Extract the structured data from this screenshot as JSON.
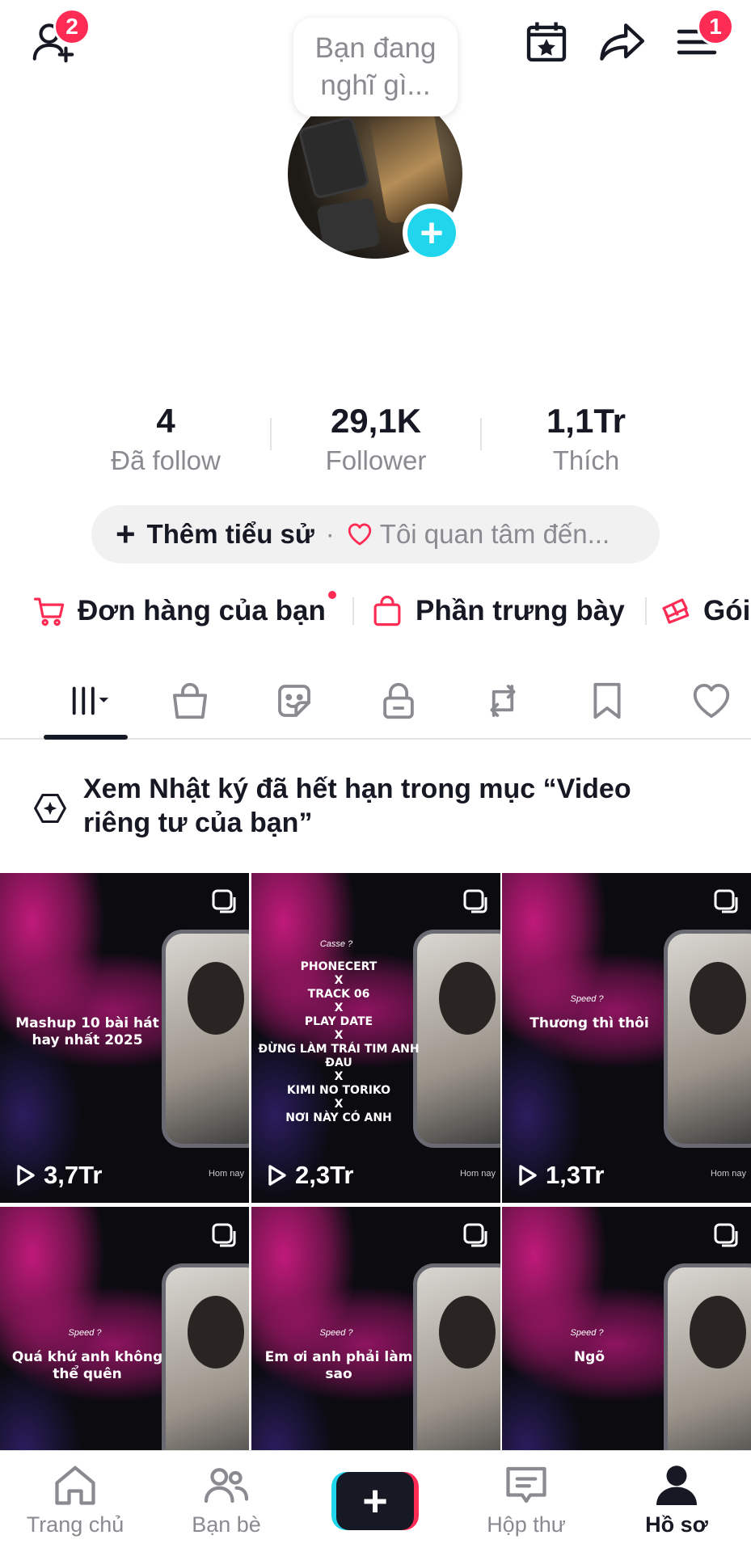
{
  "top_bar": {
    "add_friends_badge": "2",
    "menu_badge": "1"
  },
  "profile": {
    "thought_bubble": "Bạn đang nghĩ gì..."
  },
  "stats": [
    {
      "value": "4",
      "label": "Đã follow"
    },
    {
      "value": "29,1K",
      "label": "Follower"
    },
    {
      "value": "1,1Tr",
      "label": "Thích"
    }
  ],
  "bio": {
    "add_bio": "Thêm tiểu sử",
    "separator": "·",
    "interest": "Tôi quan tâm đến..."
  },
  "shortcuts": [
    {
      "label": "Đơn hàng của bạn",
      "icon": "cart-icon"
    },
    {
      "label": "Phần trưng bày",
      "icon": "shopping-bag-icon"
    },
    {
      "label": "Gói",
      "icon": "gift-icon"
    }
  ],
  "tabs": [
    {
      "icon": "videos-grid-icon",
      "active": true
    },
    {
      "icon": "shop-bag-icon"
    },
    {
      "icon": "sticker-icon"
    },
    {
      "icon": "lock-icon"
    },
    {
      "icon": "repost-icon"
    },
    {
      "icon": "bookmark-icon"
    },
    {
      "icon": "heart-icon"
    }
  ],
  "notice": {
    "text": "Xem Nhật ký đã hết hạn trong mục “Video riêng tư của bạn”"
  },
  "videos": [
    {
      "title": "Mashup 10 bài hát hay nhất 2025",
      "speed": "",
      "views": "3,7Tr",
      "corner": "Hom nay"
    },
    {
      "title": "PHONECERT\nX\nTRACK 06\nX\nPLAY DATE\nX\nĐỪNG LÀM TRÁI TIM ANH ĐAU\nX\nKIMI NO TORIKO\nX\nNƠI NÀY CÓ ANH",
      "speed": "Casse ?",
      "views": "2,3Tr",
      "corner": "Hom nay"
    },
    {
      "title": "Thương thì thôi",
      "speed": "Speed ?",
      "views": "1,3Tr",
      "corner": "Hom nay"
    },
    {
      "title": "Quá khứ anh không thể quên",
      "speed": "Speed ?",
      "views": "",
      "corner": ""
    },
    {
      "title": "Em ơi anh phải làm sao",
      "speed": "Speed ?",
      "views": "",
      "corner": ""
    },
    {
      "title": "Ngõ",
      "speed": "Speed ?",
      "views": "",
      "corner": ""
    }
  ],
  "bottom_nav": [
    {
      "label": "Trang chủ",
      "icon": "home-icon"
    },
    {
      "label": "Bạn bè",
      "icon": "friends-icon"
    },
    {
      "label": "",
      "icon": "create-icon"
    },
    {
      "label": "Hộp thư",
      "icon": "inbox-icon"
    },
    {
      "label": "Hồ sơ",
      "icon": "profile-icon",
      "active": true
    }
  ],
  "colors": {
    "accent": "#fe2c55",
    "cyan": "#20d5ec",
    "text": "#161823",
    "muted": "#8a8b91"
  }
}
